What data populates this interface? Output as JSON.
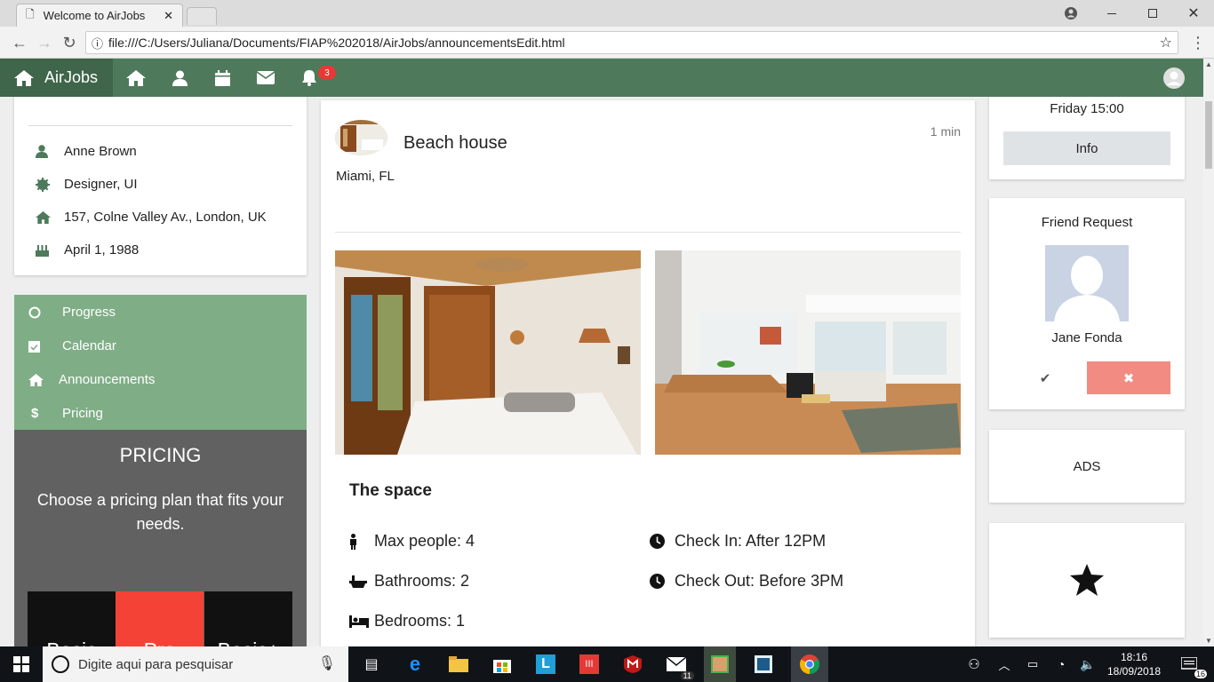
{
  "browser": {
    "tab_title": "Welcome to AirJobs",
    "close_symbol": "✕",
    "url": "file:///C:/Users/Juliana/Documents/FIAP%202018/AirJobs/announcementsEdit.html",
    "url_prefix": "ⓘ"
  },
  "appnav": {
    "brand": "AirJobs",
    "notification_count": "3",
    "icons": [
      "home-icon",
      "user-icon",
      "calendar-icon",
      "envelope-icon",
      "bell-icon"
    ]
  },
  "profile": {
    "name": "Anne Brown",
    "job": "Designer, UI",
    "address": "157, Colne Valley Av., London, UK",
    "birthday": "April 1, 1988"
  },
  "menu": {
    "items": [
      "Progress",
      "Calendar",
      "Announcements",
      "Pricing"
    ]
  },
  "pricing": {
    "title": "PRICING",
    "subtitle": "Choose a pricing plan that fits your needs.",
    "plans": [
      "Basic",
      "Pro",
      "Basic+"
    ]
  },
  "announcement": {
    "title": "Beach house",
    "time": "1 min",
    "location": "Miami, FL",
    "space_heading": "The space",
    "max_people": "Max people: 4",
    "bathrooms": "Bathrooms: 2",
    "bedrooms": "Bedrooms: 1",
    "check_in": "Check In: After 12PM",
    "check_out": "Check Out: Before 3PM"
  },
  "right": {
    "event_time": "Friday 15:00",
    "info_button": "Info",
    "friend_title": "Friend Request",
    "friend_name": "Jane Fonda",
    "accept_symbol": "✔",
    "reject_symbol": "✖",
    "ads": "ADS"
  },
  "taskbar": {
    "search_placeholder": "Digite aqui para pesquisar",
    "time": "18:16",
    "date": "18/09/2018",
    "mail_count": "11",
    "notif_count": "16"
  },
  "colors": {
    "nav": "#4e7a5b",
    "menu": "#7fae86",
    "pricing_bg": "#616161",
    "pro": "#f44336",
    "reject": "#f28b82"
  }
}
